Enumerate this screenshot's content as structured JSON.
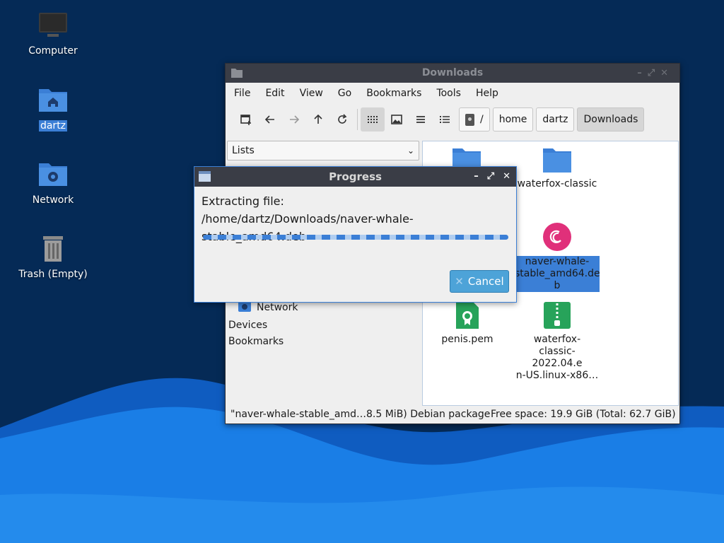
{
  "desktop": {
    "icons": [
      {
        "label": "Computer",
        "icon": "monitor-icon"
      },
      {
        "label": "dartz",
        "icon": "home-folder-icon"
      },
      {
        "label": "Network",
        "icon": "network-folder-icon"
      },
      {
        "label": "Trash (Empty)",
        "icon": "trash-icon"
      }
    ]
  },
  "file_manager": {
    "title": "Downloads",
    "menu": [
      "File",
      "Edit",
      "View",
      "Go",
      "Bookmarks",
      "Tools",
      "Help"
    ],
    "breadcrumb": [
      "/",
      "home",
      "dartz",
      "Downloads"
    ],
    "side_panel": {
      "selector": "Lists",
      "items": [
        "Network",
        "Devices",
        "Bookmarks"
      ]
    },
    "files": [
      {
        "name": "",
        "icon": "folder-icon"
      },
      {
        "name": "waterfox-classic",
        "icon": "folder-icon"
      },
      {
        "name": "naver-whale-stable_amd64.deb",
        "display": [
          "naver-whale-",
          "stable_amd64.de",
          "b"
        ],
        "icon": "debian-package-icon",
        "selected": true
      },
      {
        "name": "penis.pem",
        "icon": "certificate-icon"
      },
      {
        "name": "waterfox-classic-2022.04.en-US.linux-x86…",
        "display": [
          "waterfox-",
          "classic-2022.04.e",
          "n-US.linux-x86…"
        ],
        "icon": "archive-icon"
      }
    ],
    "status": {
      "selection": "\"naver-whale-stable_amd…8.5 MiB) Debian package",
      "free_space": "Free space: 19.9 GiB (Total: 62.7 GiB)"
    }
  },
  "progress_dialog": {
    "title": "Progress",
    "line1": "Extracting file:",
    "line2": "/home/dartz/Downloads/naver-whale-stable_amd64.deb",
    "cancel_label": "Cancel"
  },
  "colors": {
    "accent": "#3b7fd6",
    "titlebar": "#3a3d46",
    "desktop": "#062a55",
    "wave": "#1a7ee6"
  }
}
